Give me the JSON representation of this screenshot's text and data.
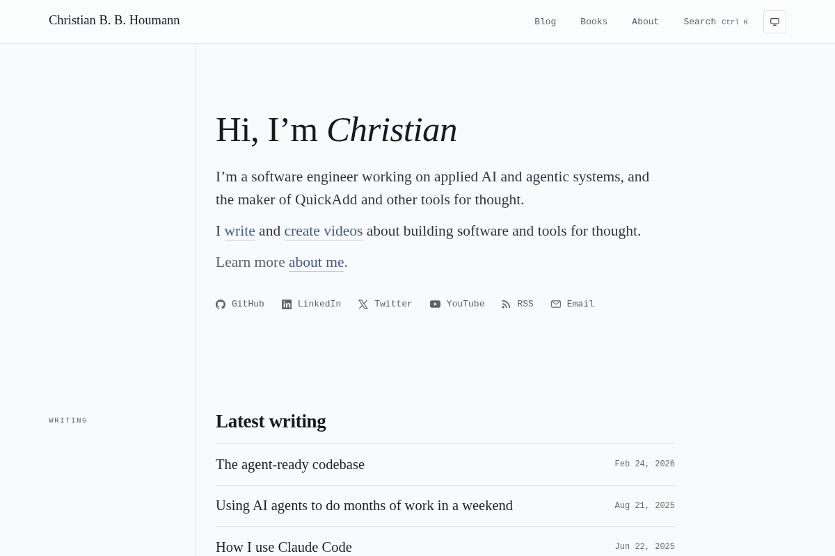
{
  "header": {
    "site_title": "Christian B. B. Houmann",
    "nav": [
      {
        "label": "Blog"
      },
      {
        "label": "Books"
      },
      {
        "label": "About"
      }
    ],
    "search": {
      "label": "Search",
      "shortcut": "Ctrl K"
    }
  },
  "hero": {
    "heading": "Hi, I’m *Christian*",
    "paragraphs": [
      {
        "muted": false,
        "parts": [
          {
            "kind": "text",
            "text": "I’m a software engineer working on applied AI and agentic systems, and the maker of QuickAdd and other tools for thought."
          }
        ]
      },
      {
        "muted": false,
        "parts": [
          {
            "kind": "text",
            "text": "I "
          },
          {
            "kind": "link",
            "text": "write"
          },
          {
            "kind": "text",
            "text": " and "
          },
          {
            "kind": "link",
            "text": "create videos"
          },
          {
            "kind": "text",
            "text": " about building software and tools for thought."
          }
        ]
      },
      {
        "muted": true,
        "parts": [
          {
            "kind": "text",
            "text": "Learn more "
          },
          {
            "kind": "link",
            "text": "about me"
          },
          {
            "kind": "text",
            "text": "."
          }
        ]
      }
    ],
    "social_links": [
      {
        "kind": "github",
        "label": "GitHub"
      },
      {
        "kind": "linkedin",
        "label": "LinkedIn"
      },
      {
        "kind": "x",
        "label": "Twitter"
      },
      {
        "kind": "youtube",
        "label": "YouTube"
      },
      {
        "kind": "rss",
        "label": "RSS"
      },
      {
        "kind": "email",
        "label": "Email"
      }
    ]
  },
  "writing": {
    "section_label": "WRITING",
    "heading": "Latest writing",
    "posts": [
      {
        "title": "The agent-ready codebase",
        "date": "Feb 24, 2026"
      },
      {
        "title": "Using AI agents to do months of work in a weekend",
        "date": "Aug 21, 2025"
      },
      {
        "title": "How I use Claude Code",
        "date": "Jun 22, 2025"
      }
    ]
  }
}
